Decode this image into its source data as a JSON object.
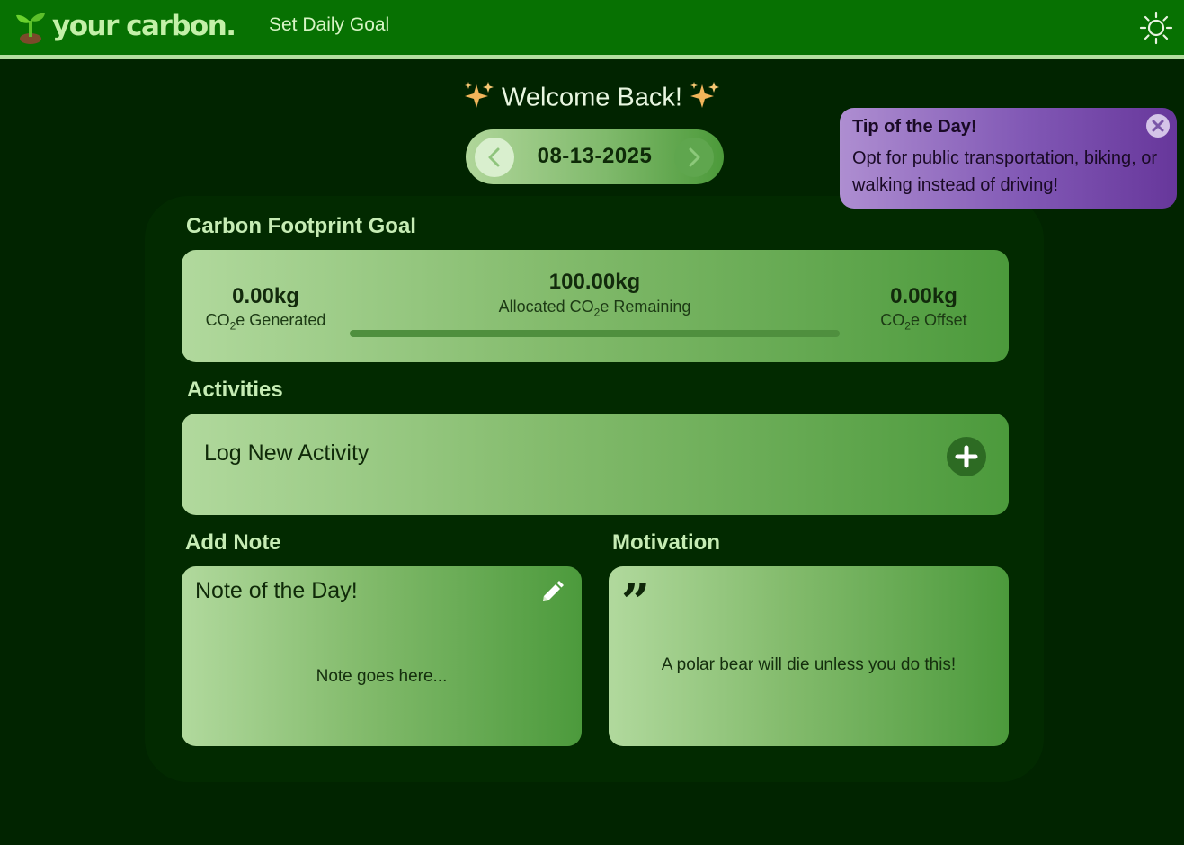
{
  "header": {
    "logo_text": "your carbon.",
    "nav_link": "Set Daily Goal",
    "theme_icon": "sun-icon"
  },
  "welcome": {
    "text": "Welcome Back!",
    "icon": "sparkles-icon"
  },
  "date_nav": {
    "date": "08-13-2025",
    "prev_icon": "chevron-left-icon",
    "next_icon": "chevron-right-icon"
  },
  "tip": {
    "title": "Tip of the Day!",
    "body": "Opt for public transportation, biking, or walking instead of driving!",
    "close_icon": "close-icon"
  },
  "goal": {
    "section_title": "Carbon Footprint Goal",
    "generated_value": "0.00kg",
    "generated_label_pre": "CO",
    "generated_label_sub": "2",
    "generated_label_post": "e Generated",
    "remaining_value": "100.00kg",
    "remaining_label_pre": "Allocated CO",
    "remaining_label_sub": "2",
    "remaining_label_post": "e Remaining",
    "offset_value": "0.00kg",
    "offset_label_pre": "CO",
    "offset_label_sub": "2",
    "offset_label_post": "e Offset",
    "progress_fraction": 0
  },
  "activities": {
    "section_title": "Activities",
    "log_label": "Log New Activity",
    "add_icon": "plus-icon"
  },
  "note": {
    "section_title": "Add Note",
    "title": "Note of the Day!",
    "body": "Note goes here...",
    "edit_icon": "pencil-icon"
  },
  "motivation": {
    "section_title": "Motivation",
    "quote_mark": "”",
    "text": "A polar bear will die unless you do this!"
  },
  "colors": {
    "background": "#012400",
    "topbar": "#077102",
    "accent_light": "#c6ecb4",
    "tip_purple": "#8158b5"
  }
}
